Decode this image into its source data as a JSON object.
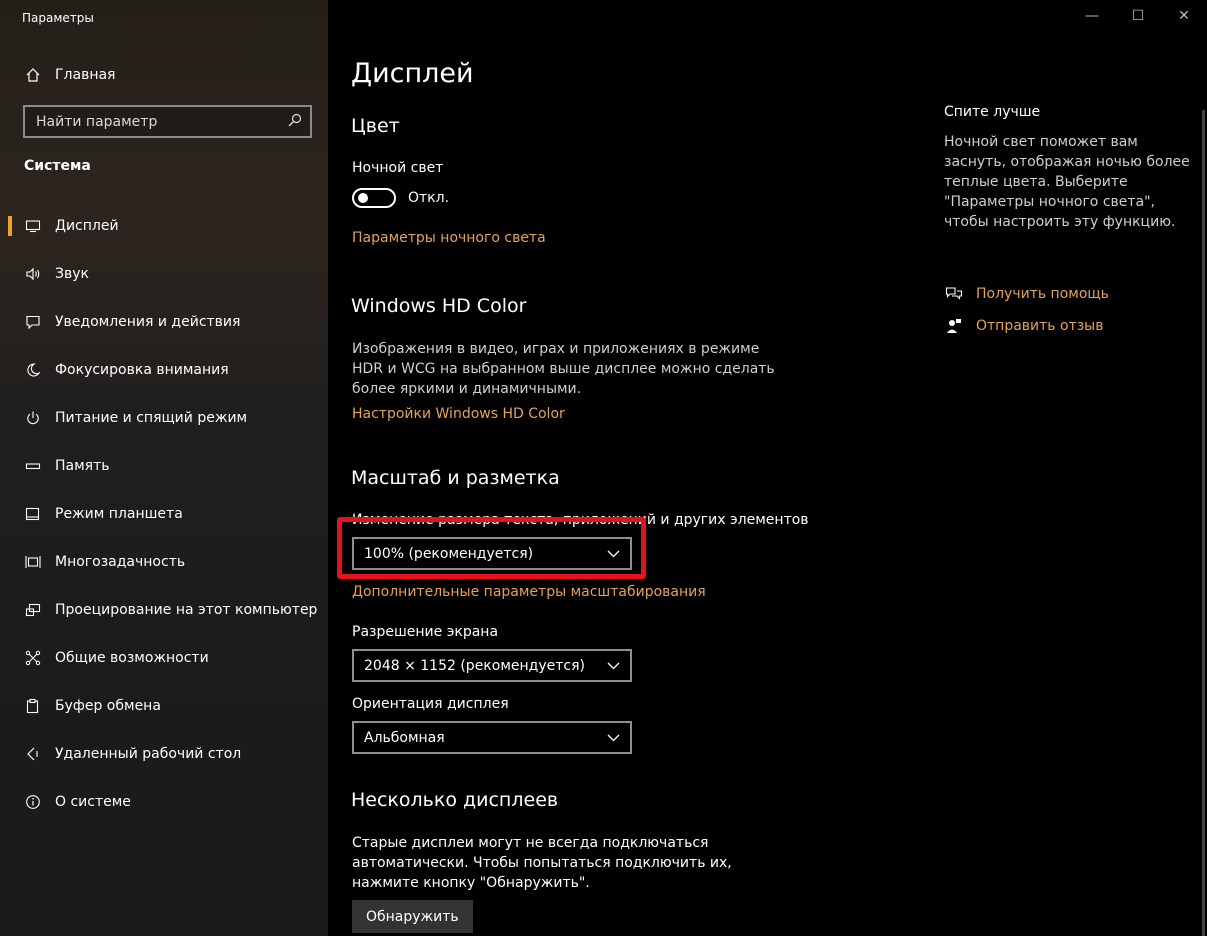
{
  "window": {
    "title": "Параметры"
  },
  "sidebar": {
    "home_label": "Главная",
    "search_placeholder": "Найти параметр",
    "section_title": "Система",
    "items": [
      {
        "label": "Дисплей",
        "icon": "monitor-icon",
        "active": true
      },
      {
        "label": "Звук",
        "icon": "speaker-icon"
      },
      {
        "label": "Уведомления и действия",
        "icon": "notification-icon"
      },
      {
        "label": "Фокусировка внимания",
        "icon": "moon-icon"
      },
      {
        "label": "Питание и спящий режим",
        "icon": "power-icon"
      },
      {
        "label": "Память",
        "icon": "storage-icon"
      },
      {
        "label": "Режим планшета",
        "icon": "tablet-icon"
      },
      {
        "label": "Многозадачность",
        "icon": "multitask-icon"
      },
      {
        "label": "Проецирование на этот компьютер",
        "icon": "project-icon"
      },
      {
        "label": "Общие возможности",
        "icon": "shared-icon"
      },
      {
        "label": "Буфер обмена",
        "icon": "clipboard-icon"
      },
      {
        "label": "Удаленный рабочий стол",
        "icon": "remote-icon"
      },
      {
        "label": "О системе",
        "icon": "info-icon"
      }
    ]
  },
  "main": {
    "title": "Дисплей",
    "color_section": "Цвет",
    "night_light_label": "Ночной свет",
    "night_light_state": "Откл.",
    "night_light_link": "Параметры ночного света",
    "hd_section": "Windows HD Color",
    "hd_desc": "Изображения в видео, играх и приложениях в режиме HDR и WCG на выбранном выше дисплее можно сделать более яркими и динамичными.",
    "hd_link": "Настройки Windows HD Color",
    "scale_section": "Масштаб и разметка",
    "scale_label": "Изменение размера текста, приложений и других элементов",
    "scale_value": "100% (рекомендуется)",
    "scale_link": "Дополнительные параметры масштабирования",
    "resolution_label": "Разрешение экрана",
    "resolution_value": "2048 × 1152 (рекомендуется)",
    "orientation_label": "Ориентация дисплея",
    "orientation_value": "Альбомная",
    "multi_section": "Несколько дисплеев",
    "multi_desc": "Старые дисплеи могут не всегда подключаться автоматически. Чтобы попытаться подключить их, нажмите кнопку \"Обнаружить\".",
    "detect_button": "Обнаружить"
  },
  "right_panel": {
    "title": "Спите лучше",
    "desc": "Ночной свет поможет вам заснуть, отображая ночью более теплые цвета. Выберите \"Параметры ночного света\", чтобы настроить эту функцию.",
    "help_link": "Получить помощь",
    "feedback_link": "Отправить отзыв"
  },
  "colors": {
    "accent": "#e3a25a",
    "highlight": "#e5121a",
    "active_marker": "#f0a32a"
  }
}
